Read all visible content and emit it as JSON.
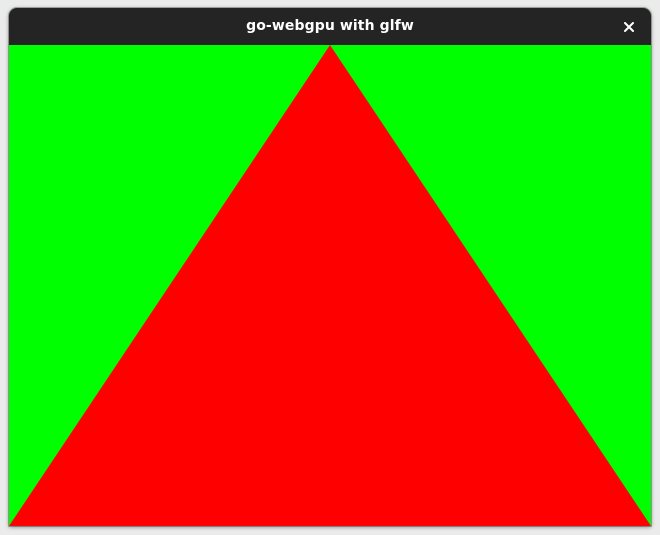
{
  "window": {
    "title": "go-webgpu with glfw",
    "close_icon": "close-icon"
  },
  "render": {
    "clear_color": "#00ff00",
    "triangle_color": "#ff0000"
  }
}
